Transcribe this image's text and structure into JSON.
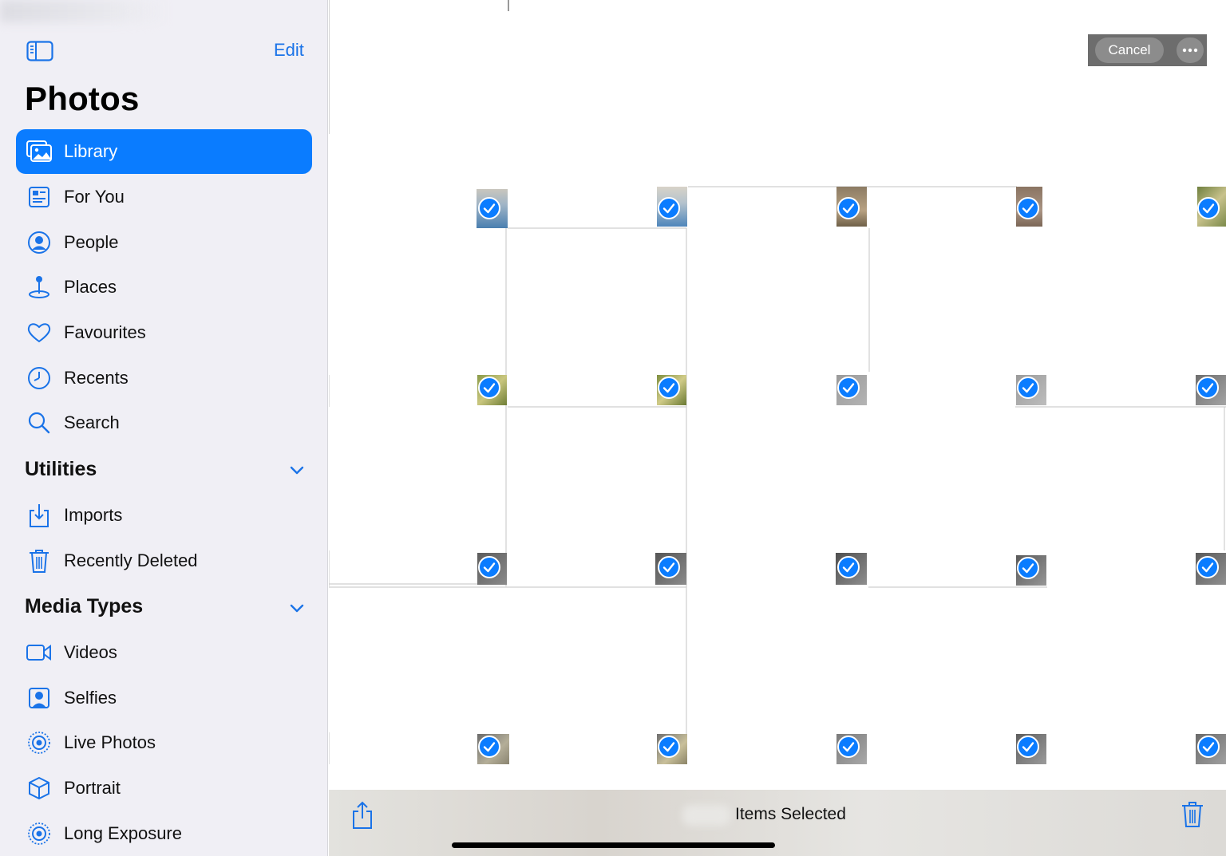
{
  "sidebar": {
    "edit_label": "Edit",
    "title": "Photos",
    "items": [
      {
        "label": "Library",
        "icon": "library-icon",
        "active": true
      },
      {
        "label": "For You",
        "icon": "for-you-icon"
      },
      {
        "label": "People",
        "icon": "people-icon"
      },
      {
        "label": "Places",
        "icon": "places-icon"
      },
      {
        "label": "Favourites",
        "icon": "heart-icon"
      },
      {
        "label": "Recents",
        "icon": "clock-icon"
      },
      {
        "label": "Search",
        "icon": "search-icon"
      }
    ],
    "utilities": {
      "title": "Utilities",
      "items": [
        {
          "label": "Imports",
          "icon": "import-icon"
        },
        {
          "label": "Recently Deleted",
          "icon": "trash-icon"
        }
      ]
    },
    "media_types": {
      "title": "Media Types",
      "items": [
        {
          "label": "Videos",
          "icon": "video-icon"
        },
        {
          "label": "Selfies",
          "icon": "selfie-icon"
        },
        {
          "label": "Live Photos",
          "icon": "live-photo-icon"
        },
        {
          "label": "Portrait",
          "icon": "cube-icon"
        },
        {
          "label": "Long Exposure",
          "icon": "live-photo-icon"
        }
      ]
    }
  },
  "header": {
    "cancel_label": "Cancel"
  },
  "toolbar": {
    "selection_label": "Items Selected"
  },
  "colors": {
    "accent": "#0a7cff",
    "sidebar_bg": "#f0eff5"
  }
}
